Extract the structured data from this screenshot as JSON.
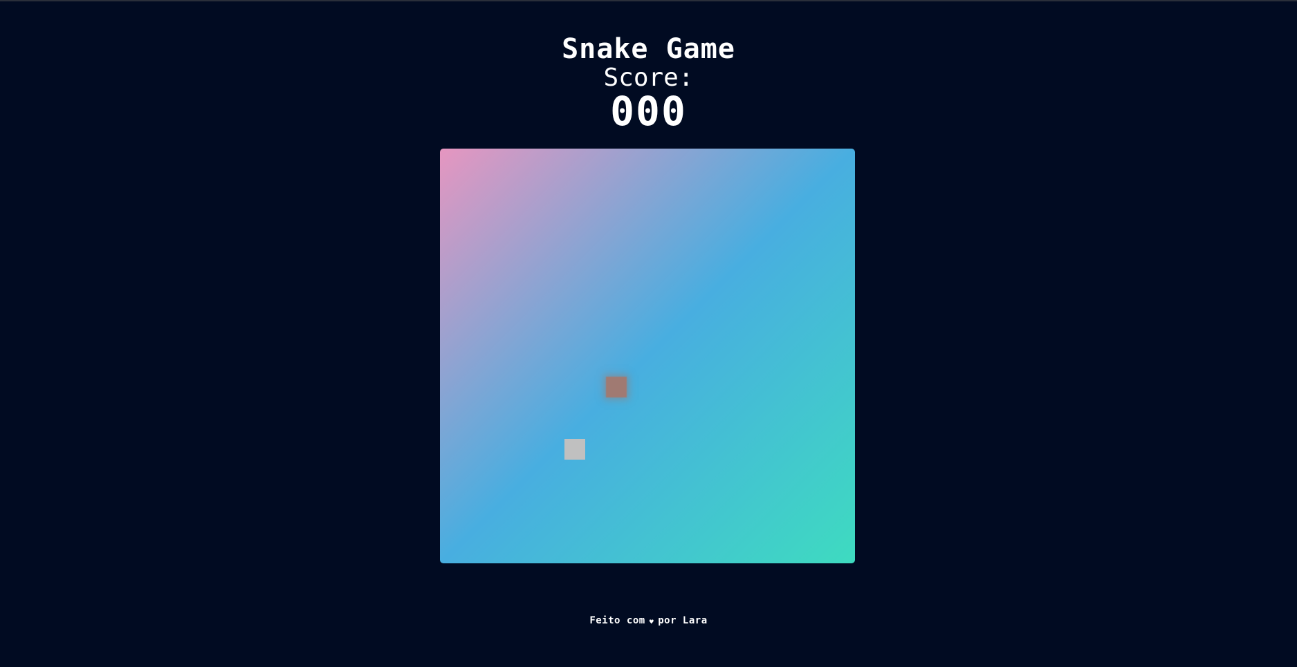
{
  "header": {
    "title": "Snake Game",
    "score_label": "Score:",
    "score_value": "000"
  },
  "board": {
    "gradient": [
      "#e696c0",
      "#48aee0",
      "#3edbc0"
    ],
    "grid_cells": 20,
    "food": {
      "col": 8,
      "row": 11,
      "color": "#a07a72"
    },
    "snake": [
      {
        "col": 6,
        "row": 14,
        "color": "#c0c0c0"
      }
    ]
  },
  "footer": {
    "made_with": "Feito com",
    "heart_icon": "heart-icon",
    "by_author": "por Lara"
  },
  "colors": {
    "background": "#010b22",
    "text": "#ffffff"
  }
}
